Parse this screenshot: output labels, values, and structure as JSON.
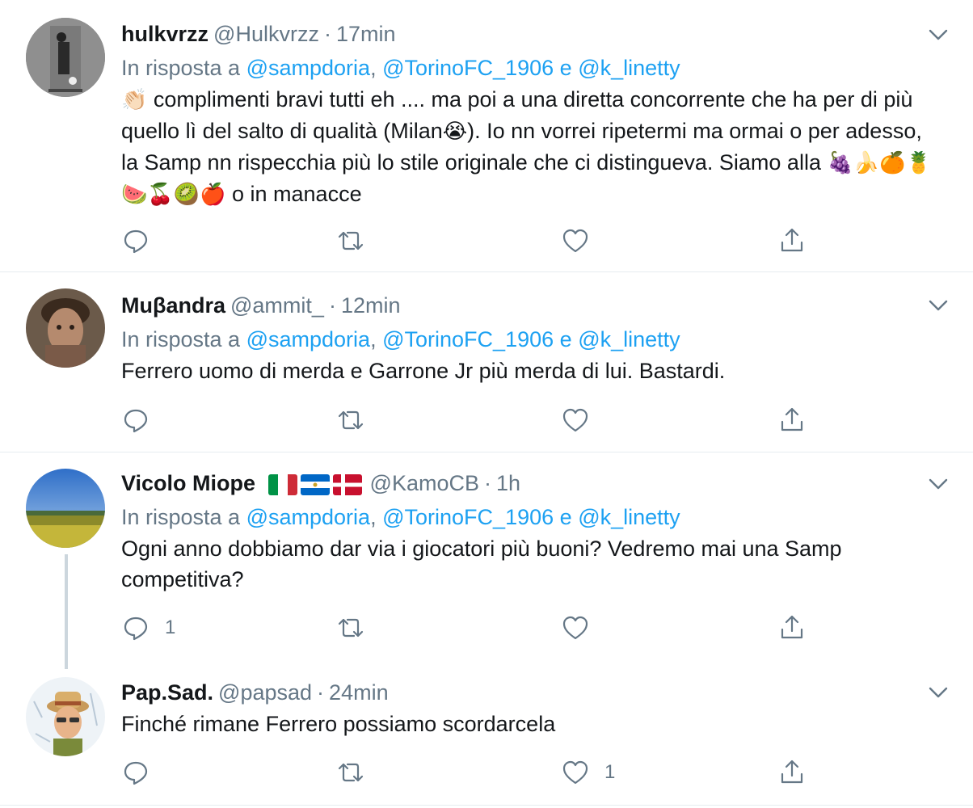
{
  "tweets": [
    {
      "name": "hulkvrzz",
      "handle": "@Hulkvrzz",
      "time": "17min",
      "reply_prefix": "In risposta a",
      "mention_1": "@sampdoria",
      "mention_2": "@TorinoFC_1906",
      "conj": "e",
      "mention_3": "@k_linetty",
      "text_parts": {
        "clap": "👏🏻",
        "a": " complimenti bravi tutti eh .... ma poi a una diretta concorrente che ha per di più quello lì del salto di qualità (Milan",
        "cry": "😭",
        "b": "). Io nn vorrei ripetermi ma ormai o per adesso, la Samp nn rispecchia più lo stile originale che ci distingueva. Siamo alla ",
        "fruits": "🍇🍌🍊🍍🍉🍒🥝🍎",
        "c": " o in manacce"
      },
      "reply_count": "",
      "like_count": ""
    },
    {
      "name": "Muβandra",
      "handle": "@ammit_",
      "time": "12min",
      "reply_prefix": "In risposta a",
      "mention_1": "@sampdoria",
      "mention_2": "@TorinoFC_1906",
      "conj": "e",
      "mention_3": "@k_linetty",
      "text": "Ferrero uomo di merda e Garrone Jr più merda di lui. Bastardi.",
      "reply_count": "",
      "like_count": ""
    },
    {
      "name": "Vicolo Miope",
      "handle": "@KamoCB",
      "time": "1h",
      "reply_prefix": "In risposta a",
      "mention_1": "@sampdoria",
      "mention_2": "@TorinoFC_1906",
      "conj": "e",
      "mention_3": "@k_linetty",
      "text": "Ogni anno dobbiamo dar via i giocatori più buoni? Vedremo mai una Samp competitiva?",
      "reply_count": "1",
      "like_count": ""
    },
    {
      "name": "Pap.Sad.",
      "handle": "@papsad",
      "time": "24min",
      "text": "Finché rimane Ferrero possiamo scordarcela",
      "reply_count": "",
      "like_count": "1"
    }
  ],
  "separator": "·",
  "comma": ",",
  "icons": {
    "reply": "reply-icon",
    "retweet": "retweet-icon",
    "like": "heart-icon",
    "share": "share-icon",
    "menu": "chevron-down-icon"
  },
  "colors": {
    "link": "#1da1f2",
    "muted": "#657786",
    "text": "#14171a",
    "divider": "#e6ecf0"
  }
}
